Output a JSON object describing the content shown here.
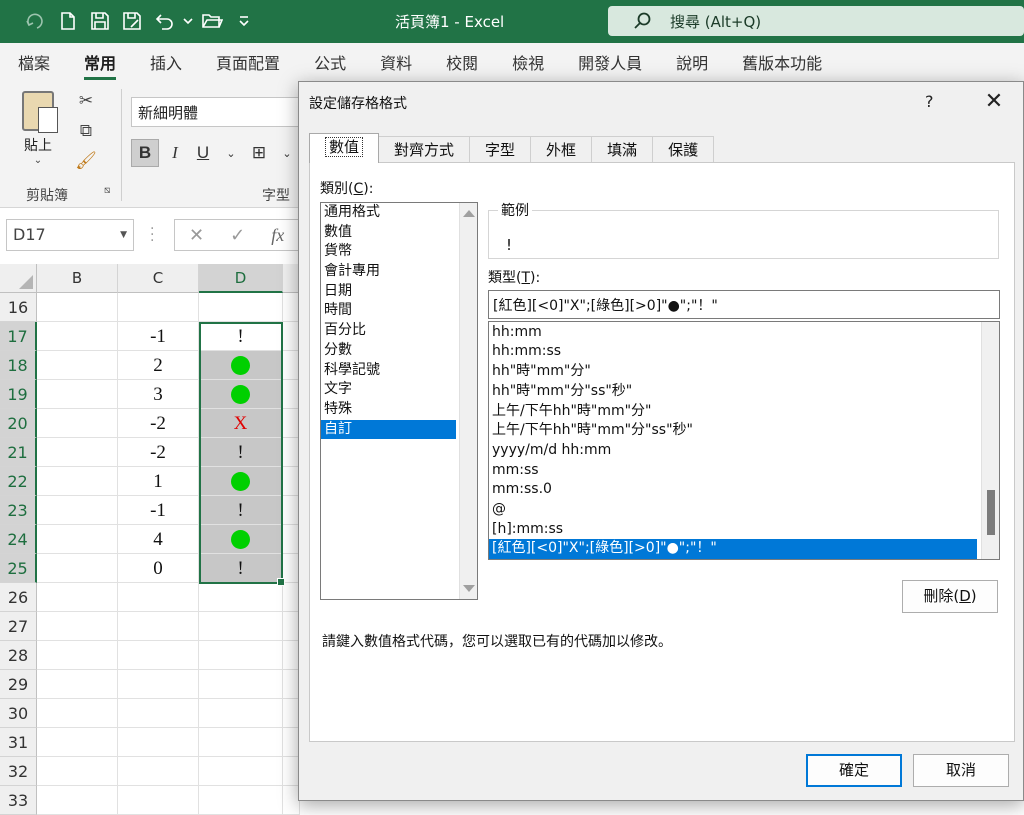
{
  "app": {
    "window_title": "活頁簿1  -  Excel",
    "search_placeholder": "搜尋 (Alt+Q)"
  },
  "ribbon": {
    "tabs": [
      "檔案",
      "常用",
      "插入",
      "頁面配置",
      "公式",
      "資料",
      "校閱",
      "檢視",
      "開發人員",
      "說明",
      "舊版本功能"
    ],
    "active_tab": "常用",
    "paste_label": "貼上",
    "clipboard_group": "剪貼簿",
    "font_group": "字型",
    "font_name": "新細明體",
    "bold": "B",
    "italic": "I",
    "underline": "U"
  },
  "formula_bar": {
    "name_box": "D17",
    "fx": "fx",
    "cancel": "✕",
    "enter": "✓"
  },
  "sheet": {
    "columns": [
      "B",
      "C",
      "D"
    ],
    "selected_column": "D",
    "rows": [
      {
        "num": "16",
        "c": "",
        "d": ""
      },
      {
        "num": "17",
        "c": "-1",
        "d": "!"
      },
      {
        "num": "18",
        "c": "2",
        "d": "●"
      },
      {
        "num": "19",
        "c": "3",
        "d": "●"
      },
      {
        "num": "20",
        "c": "-2",
        "d": "X"
      },
      {
        "num": "21",
        "c": "-2",
        "d": "!"
      },
      {
        "num": "22",
        "c": "1",
        "d": "●"
      },
      {
        "num": "23",
        "c": "-1",
        "d": "!"
      },
      {
        "num": "24",
        "c": "4",
        "d": "●"
      },
      {
        "num": "25",
        "c": "0",
        "d": "!"
      },
      {
        "num": "26",
        "c": "",
        "d": ""
      },
      {
        "num": "27",
        "c": "",
        "d": ""
      },
      {
        "num": "28",
        "c": "",
        "d": ""
      },
      {
        "num": "29",
        "c": "",
        "d": ""
      },
      {
        "num": "30",
        "c": "",
        "d": ""
      },
      {
        "num": "31",
        "c": "",
        "d": ""
      },
      {
        "num": "32",
        "c": "",
        "d": ""
      },
      {
        "num": "33",
        "c": "",
        "d": ""
      }
    ],
    "colors": {
      "green_dot": "#00d000",
      "red_x": "#e00000",
      "selection": "#217346"
    }
  },
  "dialog": {
    "title": "設定儲存格格式",
    "help": "?",
    "close": "✕",
    "tabs": [
      "數值",
      "對齊方式",
      "字型",
      "外框",
      "填滿",
      "保護"
    ],
    "active_tab": "數值",
    "category_label_pre": "類別(",
    "category_label_key": "C",
    "category_label_post": "):",
    "categories": [
      "通用格式",
      "數值",
      "貨幣",
      "會計專用",
      "日期",
      "時間",
      "百分比",
      "分數",
      "科學記號",
      "文字",
      "特殊",
      "自訂"
    ],
    "selected_category": "自訂",
    "sample_label": "範例",
    "sample_value": "!",
    "type_label_pre": "類型(",
    "type_label_key": "T",
    "type_label_post": "):",
    "type_value": "[紅色][<0]\"X\";[綠色][>0]\"●\";\"！\"",
    "formats": [
      "hh:mm",
      "hh:mm:ss",
      "hh\"時\"mm\"分\"",
      "hh\"時\"mm\"分\"ss\"秒\"",
      "上午/下午hh\"時\"mm\"分\"",
      "上午/下午hh\"時\"mm\"分\"ss\"秒\"",
      "yyyy/m/d hh:mm",
      "mm:ss",
      "mm:ss.0",
      "@",
      "[h]:mm:ss",
      "[紅色][<0]\"X\";[綠色][>0]\"●\";\"！\""
    ],
    "selected_format_index": 11,
    "delete_pre": "刪除(",
    "delete_key": "D",
    "delete_post": ")",
    "hint": "請鍵入數值格式代碼，您可以選取已有的代碼加以修改。",
    "ok": "確定",
    "cancel": "取消"
  }
}
